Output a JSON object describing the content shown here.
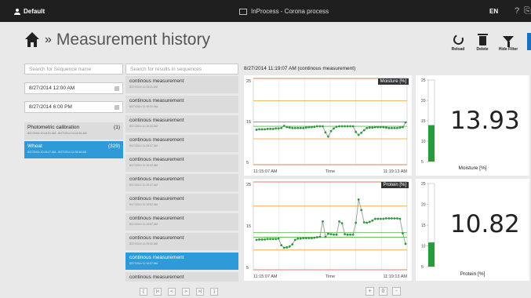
{
  "topbar": {
    "user": "Default",
    "app_title": "InProcess - Corona process",
    "language": "EN",
    "help": "?"
  },
  "header": {
    "title": "Measurement history",
    "separator": "»",
    "actions": [
      {
        "label": "Reload",
        "icon": "reload-icon"
      },
      {
        "label": "Delete",
        "icon": "trash-icon"
      },
      {
        "label": "Hide Filter",
        "icon": "filter-icon"
      }
    ]
  },
  "filters": {
    "sequence_search_placeholder": "Search for Sequence name",
    "results_search_placeholder": "Search for results in sequences",
    "date_from": "8/27/2014 12:00 AM",
    "date_to": "8/27/2014 6:00 PM",
    "items": [
      {
        "name": "Photometric calibration",
        "count": "(1)",
        "range": "8/27/2014 10:44:51 AM - 8/27/2014 10:44:51 AM"
      },
      {
        "name": "Wheat",
        "count": "(329)",
        "range": "8/27/2014 10:45:47 AM - 8/27/2014 11:06:48 AM"
      }
    ]
  },
  "sequences": [
    {
      "name": "continous measurement",
      "time": "8/27/2014 11:19:21 AM"
    },
    {
      "name": "continous measurement",
      "time": "8/27/2014 11:19:31 AM"
    },
    {
      "name": "continous measurement",
      "time": "8/27/2014 11:19:32 AM"
    },
    {
      "name": "continous measurement",
      "time": "8/27/2014 11:19:37 AM"
    },
    {
      "name": "continous measurement",
      "time": "8/27/2014 11:19:42 AM"
    },
    {
      "name": "continous measurement",
      "time": "8/27/2014 11:19:47 AM"
    },
    {
      "name": "continous measurement",
      "time": "8/27/2014 11:19:52 AM"
    },
    {
      "name": "continous measurement",
      "time": "8/27/2014 11:19:57 AM"
    },
    {
      "name": "continous measurement",
      "time": "8/27/2014 11:19:02 AM"
    },
    {
      "name": "continous measurement",
      "time": "8/27/2014 11:19:07 AM",
      "selected": true
    },
    {
      "name": "continous measurement",
      "time": ""
    }
  ],
  "pager": [
    "[",
    "|<",
    "<",
    ">",
    ">|",
    "]"
  ],
  "detail": {
    "title": "8/27/2014 11:19:07 AM (continous measurement)"
  },
  "zoom": [
    "+",
    "0",
    "-"
  ],
  "colors": {
    "accent": "#2e9ad8",
    "series_green": "#2a9a3a",
    "limit_orange": "#f0a32c",
    "limit_red": "#e05b2c",
    "target_green": "#56b84a",
    "gauge_fill": "#2a9a3a"
  },
  "chart_data": [
    {
      "type": "line",
      "title": "Moisture [%]",
      "xlabel": "Time",
      "x_tick_labels": [
        "11:15:07 AM",
        "11:19:13 AM"
      ],
      "y_tick_labels": [
        "25",
        "15",
        "5"
      ],
      "ylim": [
        5,
        25
      ],
      "grid": true,
      "legend": "top-right",
      "limits": {
        "upper_red": 25,
        "upper_orange": 19.8,
        "target_green_high": 14.9,
        "target_green_low": 13.9,
        "lower_orange": 11,
        "lower_red": 5
      },
      "series": [
        {
          "values": [
            13.1,
            13.2,
            13.2,
            13.2,
            13.3,
            13.3,
            13.3,
            13.4,
            13.4,
            13.5,
            14.0,
            13.7,
            13.6,
            13.5,
            13.5,
            13.5,
            13.5,
            13.5,
            13.6,
            13.7,
            13.7,
            13.8,
            13.9,
            13.9,
            13.9,
            12.5,
            11.5,
            12.8,
            13.4,
            13.8,
            13.9,
            13.9,
            13.9,
            13.9,
            13.9,
            13.9,
            12.6,
            11.9,
            12.4,
            13.0,
            13.5,
            13.6,
            13.6,
            13.7,
            13.7,
            13.7,
            13.7,
            13.6,
            13.5,
            13.5,
            13.5,
            13.5,
            13.6,
            13.7,
            14.8
          ]
        }
      ]
    },
    {
      "type": "line",
      "title": "Protein [%]",
      "xlabel": "Time",
      "x_tick_labels": [
        "11:15:07 AM",
        "11:19:13 AM"
      ],
      "y_tick_labels": [
        "25",
        "15",
        "5"
      ],
      "ylim": [
        5,
        25
      ],
      "grid": true,
      "legend": "top-right",
      "limits": {
        "upper_red": 25,
        "upper_orange": 19.5,
        "target_green_high": 13.5,
        "target_green_low": 12.4,
        "lower_orange": 9.5,
        "lower_red": 5
      },
      "series": [
        {
          "values": [
            11.8,
            11.9,
            11.9,
            11.9,
            12.0,
            12.0,
            12.0,
            12.0,
            12.1,
            10.6,
            10.0,
            10.1,
            10.3,
            10.8,
            11.8,
            12.1,
            12.1,
            12.2,
            12.2,
            12.2,
            12.2,
            12.3,
            12.4,
            12.5,
            16.0,
            12.5,
            13.2,
            13.1,
            13.0,
            13.0,
            16.0,
            15.6,
            13.1,
            13.0,
            13.0,
            13.0,
            15.7,
            21.0,
            18.6,
            15.8,
            15.7,
            15.9,
            16.2,
            16.6,
            16.6,
            16.6,
            16.6,
            16.7,
            16.7,
            16.7,
            16.7,
            16.7,
            16.6,
            13.3,
            10.9
          ]
        }
      ]
    },
    {
      "type": "bar",
      "title": "Moisture [%]",
      "display_value": "13.93",
      "values": [
        13.93
      ],
      "y_tick_labels": [
        "25",
        "20",
        "15",
        "10",
        "5"
      ],
      "ylim": [
        5,
        25
      ]
    },
    {
      "type": "bar",
      "title": "Protein [%]",
      "display_value": "10.82",
      "values": [
        10.82
      ],
      "y_tick_labels": [
        "25",
        "20",
        "15",
        "10",
        "5"
      ],
      "ylim": [
        5,
        25
      ]
    }
  ]
}
